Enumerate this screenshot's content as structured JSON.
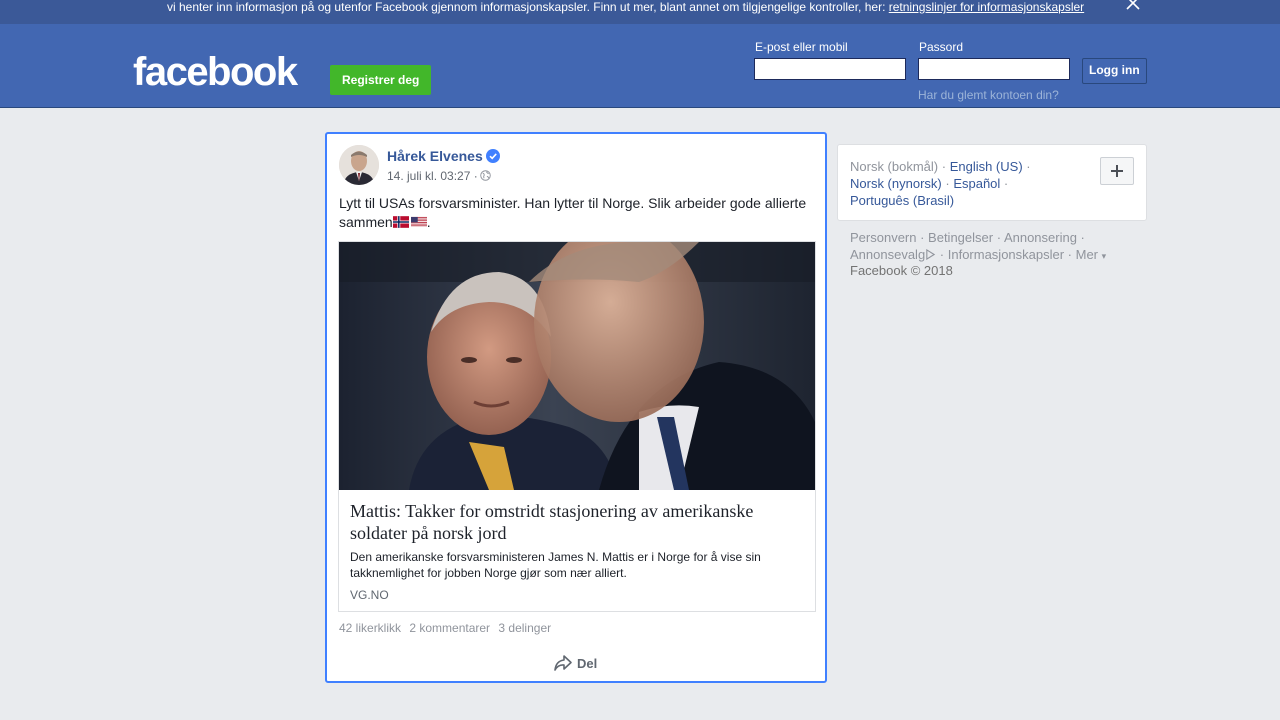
{
  "cookie_banner": {
    "text": "vi henter inn informasjon på og utenfor Facebook gjennom informasjonskapsler. Finn ut mer, blant annet om tilgjengelige kontroller, her:",
    "link": "retningslinjer for informasjonskapsler"
  },
  "header": {
    "logo": "facebook",
    "register_label": "Registrer deg",
    "email_label": "E-post eller mobil",
    "password_label": "Passord",
    "login_label": "Logg inn",
    "forgot_link": "Har du glemt kontoen din?"
  },
  "post": {
    "author": "Hårek Elvenes",
    "timestamp": "14. juli kl. 03:27 ·",
    "text": "Lytt til USAs forsvarsminister. Han lytter til Norge. Slik arbeider gode allierte sammen",
    "text_end": ".",
    "link": {
      "title": "Mattis: Takker for omstridt stasjonering av amerikanske soldater på norsk jord",
      "description": "Den amerikanske forsvarsministeren James N. Mattis er i Norge for å vise sin takknemlighet for jobben Norge gjør som nær alliert.",
      "domain": "VG.NO"
    },
    "stats": {
      "likes": "42 likerklikk",
      "comments": "2 kommentarer",
      "shares": "3 delinger"
    },
    "share_label": "Del"
  },
  "languages": {
    "current": "Norsk (bokmål)",
    "others": [
      "English (US)",
      "Norsk (nynorsk)",
      "Español",
      "Português (Brasil)"
    ]
  },
  "footer": {
    "links": [
      "Personvern",
      "Betingelser",
      "Annonsering",
      "Annonsevalg",
      "Informasjonskapsler",
      "Mer"
    ],
    "copyright": "Facebook © 2018"
  },
  "colors": {
    "brand": "#4267b2",
    "register": "#42b72a",
    "link": "#365899",
    "focus_border": "#4080ff"
  }
}
